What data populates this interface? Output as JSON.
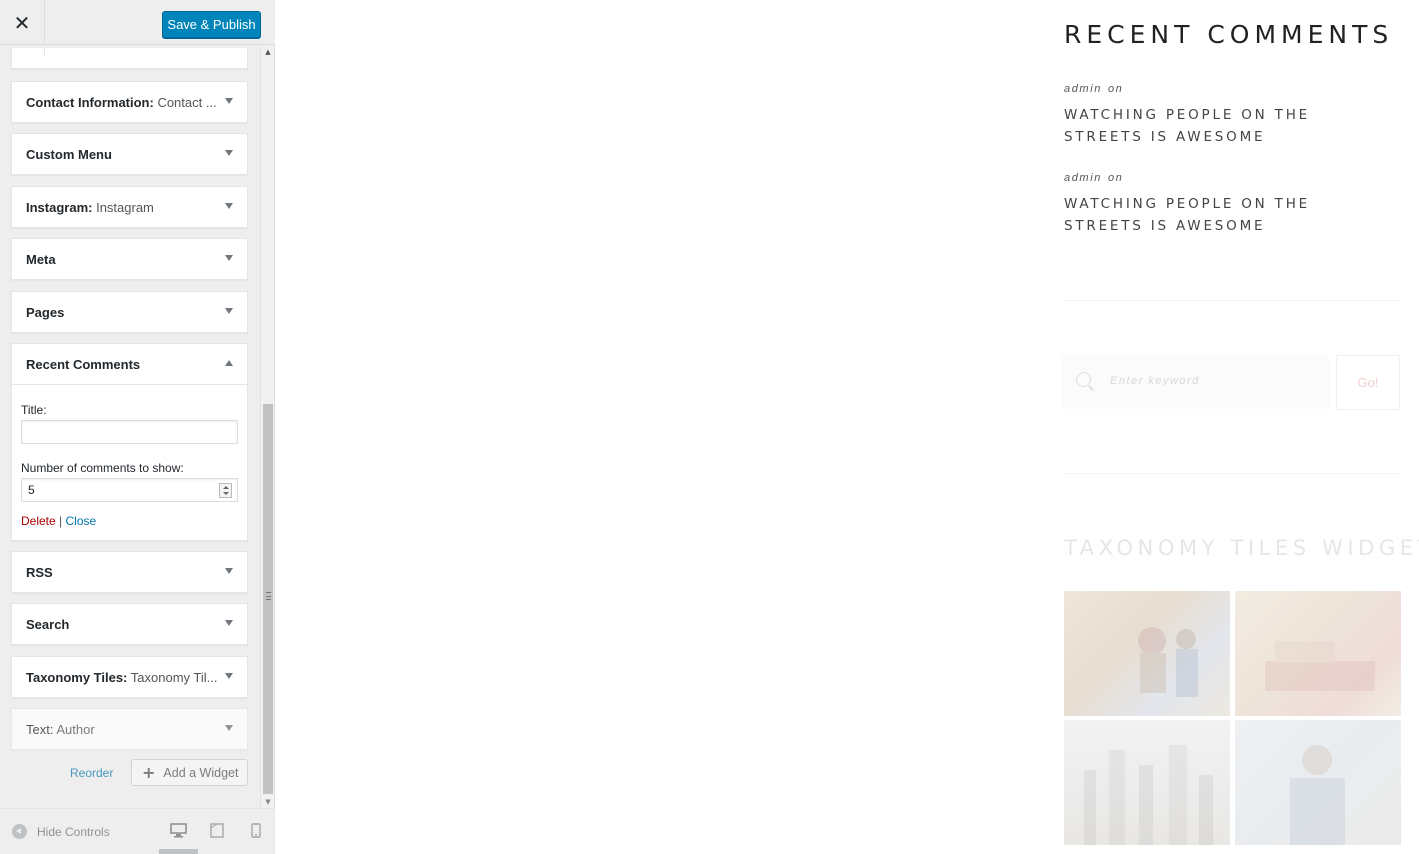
{
  "customizer": {
    "close_glyph": "✕",
    "publish_label": "Save & Publish",
    "widgets": [
      {
        "title": "Contact Information:",
        "subtitle": " Contact ..."
      },
      {
        "title": "Custom Menu",
        "subtitle": ""
      },
      {
        "title": "Instagram:",
        "subtitle": " Instagram"
      },
      {
        "title": "Meta",
        "subtitle": ""
      },
      {
        "title": "Pages",
        "subtitle": ""
      },
      {
        "title": "Recent Comments",
        "subtitle": ""
      },
      {
        "title": "RSS",
        "subtitle": ""
      },
      {
        "title": "Search",
        "subtitle": ""
      },
      {
        "title": "Taxonomy Tiles:",
        "subtitle": " Taxonomy Til..."
      },
      {
        "title": "Text:",
        "subtitle": " Author"
      }
    ],
    "expanded_form": {
      "title_label": "Title:",
      "title_value": "",
      "count_label": "Number of comments to show:",
      "count_value": "5",
      "delete_label": "Delete",
      "separator": "|",
      "close_label": "Close"
    },
    "reorder_label": "Reorder",
    "add_widget_label": "Add a Widget",
    "add_widget_glyph": "+",
    "footer": {
      "hide_controls_label": "Hide Controls",
      "active_device": "desktop"
    }
  },
  "preview": {
    "recent_comments_title": "RECENT COMMENTS",
    "comments": [
      {
        "author": "admin",
        "on": "on",
        "post": "WATCHING PEOPLE ON THE STREETS IS AWESOME"
      },
      {
        "author": "admin",
        "on": "on",
        "post": "WATCHING PEOPLE ON THE STREETS IS AWESOME"
      }
    ],
    "search_placeholder": "Enter keyword",
    "search_button": "Go!",
    "taxonomy_title": "TAXONOMY TILES WIDGET"
  },
  "colors": {
    "publish_blue": "#0085ba",
    "link_blue": "#0073aa",
    "delete_red": "#aa0000"
  }
}
